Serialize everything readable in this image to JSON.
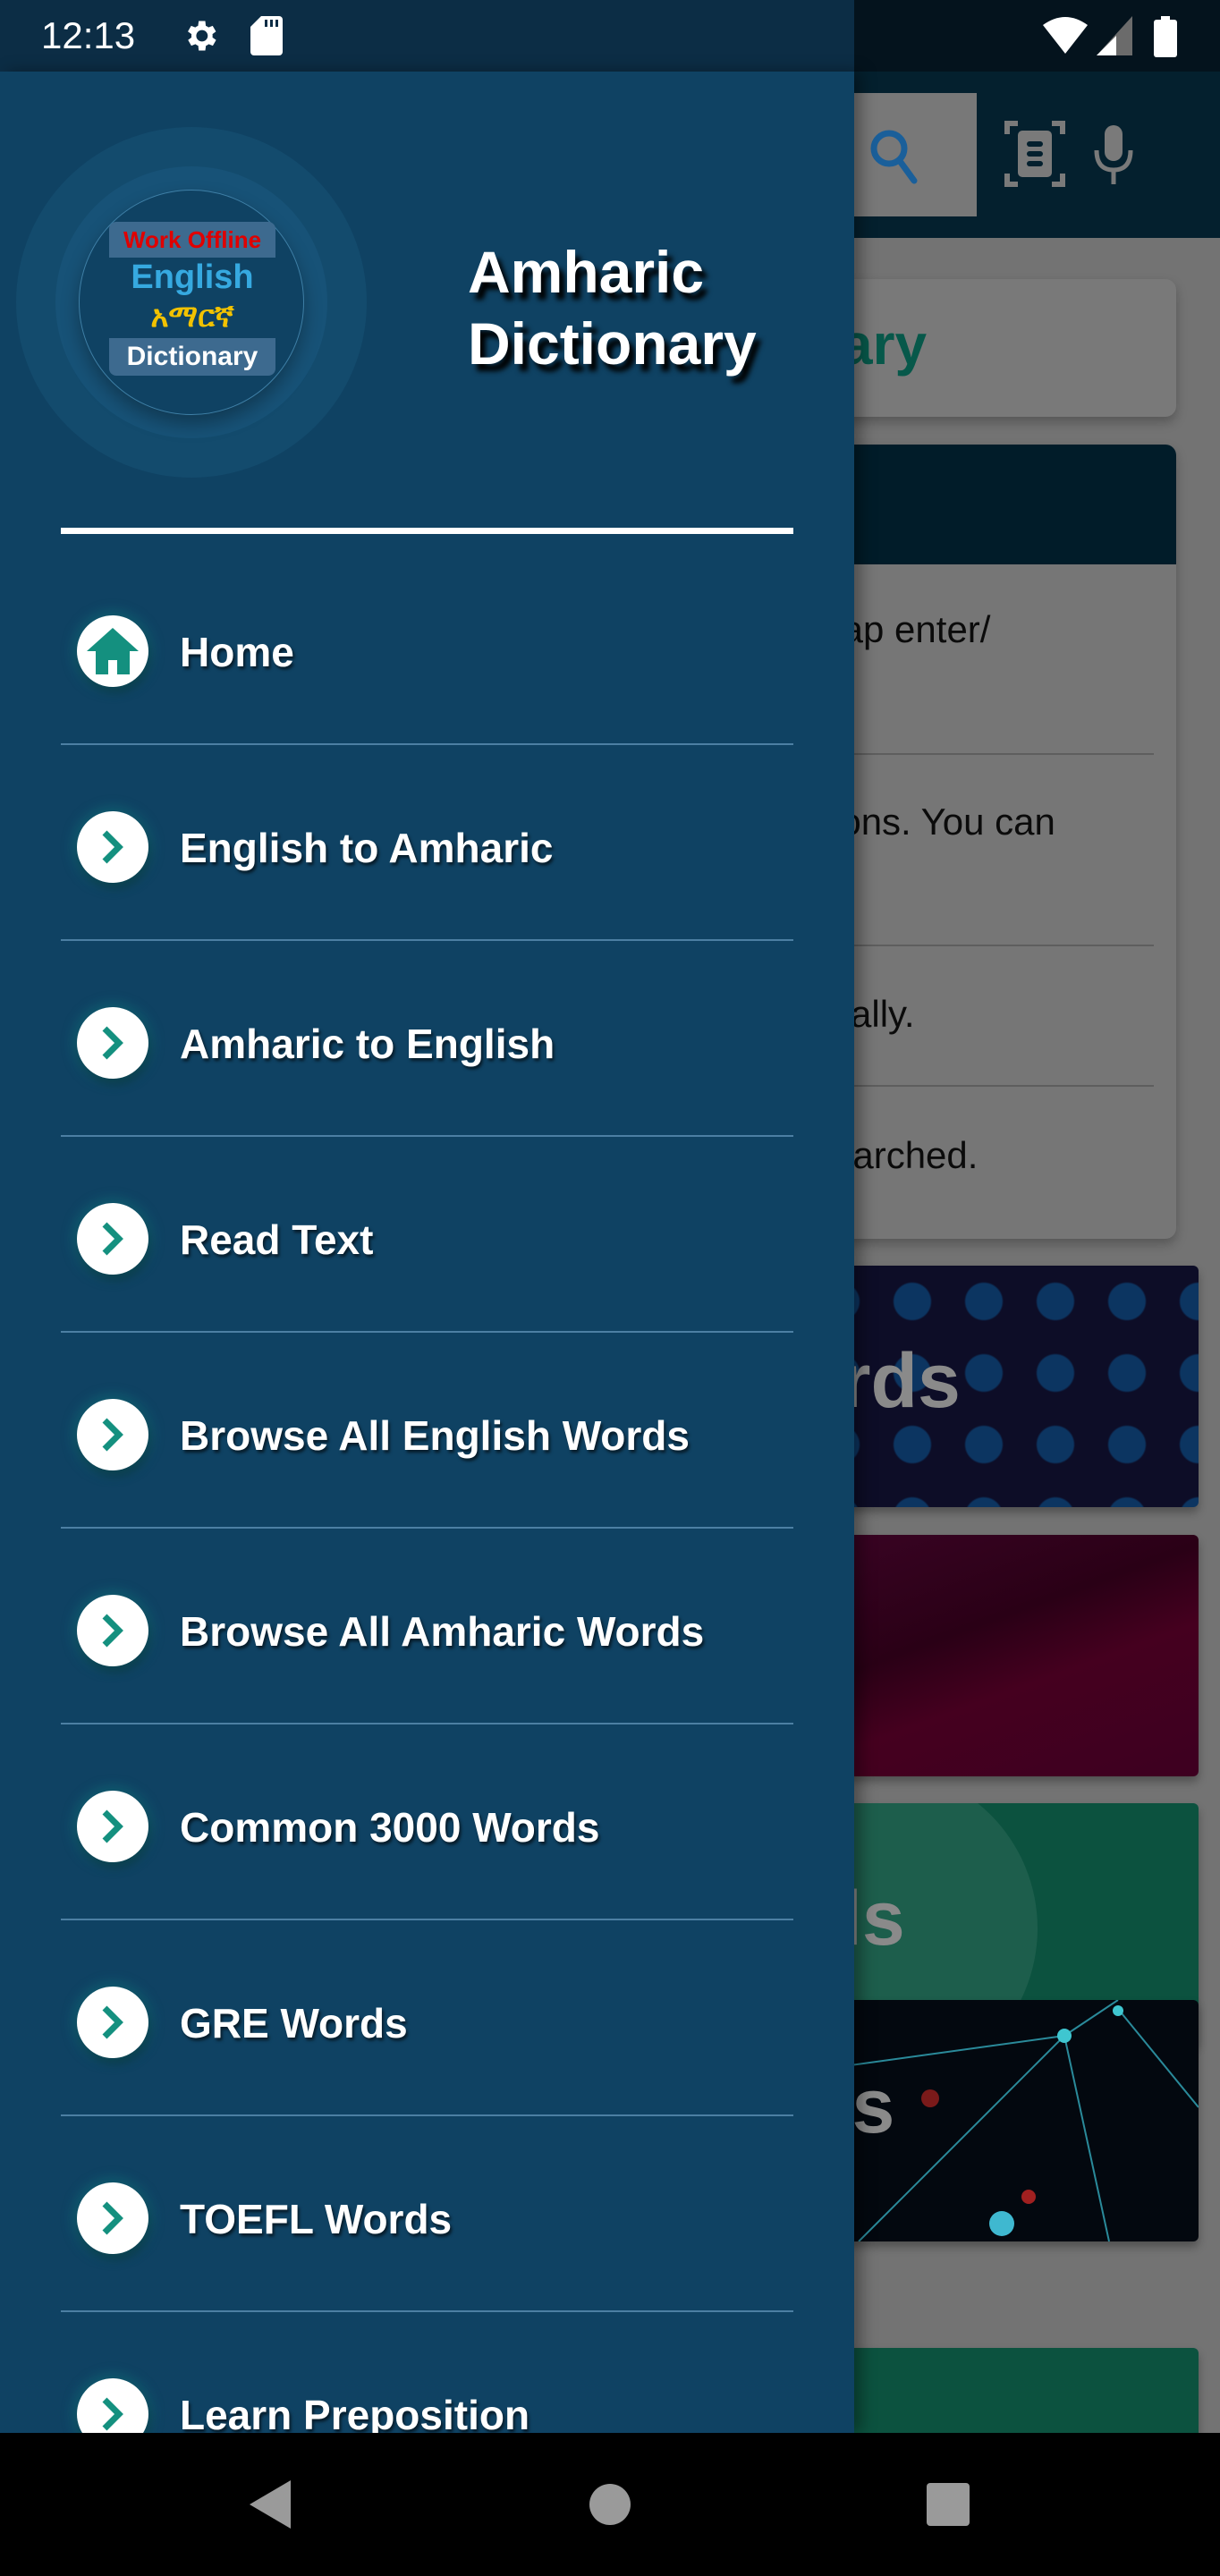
{
  "status_bar": {
    "time": "12:13",
    "left_icons": [
      "settings-icon",
      "sd-card-icon"
    ],
    "right_icons": [
      "wifi-icon",
      "cellular-signal-icon",
      "battery-icon"
    ]
  },
  "drawer": {
    "logo": {
      "top_text": "Work Offline",
      "english_text": "English",
      "amharic_text": "አማርኛ",
      "bottom_text": "Dictionary"
    },
    "title": "Amharic Dictionary",
    "menu_items": [
      {
        "label": "Home",
        "icon": "home-icon"
      },
      {
        "label": "English to Amharic",
        "icon": "chevron-right-icon"
      },
      {
        "label": "Amharic to English",
        "icon": "chevron-right-icon"
      },
      {
        "label": "Read Text",
        "icon": "chevron-right-icon"
      },
      {
        "label": "Browse All English Words",
        "icon": "chevron-right-icon"
      },
      {
        "label": "Browse All Amharic Words",
        "icon": "chevron-right-icon"
      },
      {
        "label": "Common 3000 Words",
        "icon": "chevron-right-icon"
      },
      {
        "label": "GRE Words",
        "icon": "chevron-right-icon"
      },
      {
        "label": "TOEFL Words",
        "icon": "chevron-right-icon"
      },
      {
        "label": "Learn Preposition",
        "icon": "chevron-right-icon"
      }
    ]
  },
  "background_app": {
    "toolbar_icons": [
      "search-icon",
      "document-scan-icon",
      "microphone-icon"
    ],
    "title_card_fragment": "ary",
    "info_lines": [
      "tap enter/",
      "ions. You can",
      "cally.",
      "earched."
    ],
    "tiles": [
      {
        "fragment": "rds"
      },
      {
        "fragment": ""
      },
      {
        "fragment": "ls"
      },
      {
        "fragment": "ns"
      },
      {
        "fragment": ""
      }
    ]
  },
  "nav_bar": {
    "buttons": [
      "back",
      "home",
      "recents"
    ]
  },
  "colors": {
    "drawer_bg": "#0f4263",
    "accent_teal": "#14907f",
    "statusbar_bg": "#0c2d45"
  }
}
